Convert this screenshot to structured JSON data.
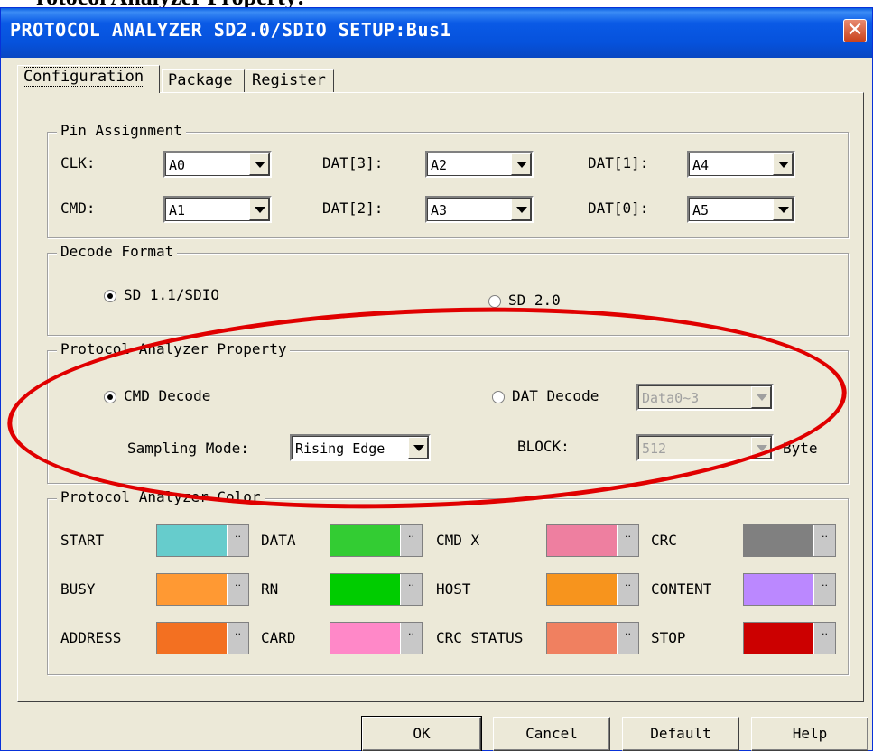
{
  "cut_heading": "rotocol Analyzer Property:",
  "window": {
    "title": "PROTOCOL ANALYZER SD2.0/SDIO SETUP:Bus1",
    "close_glyph": "✕"
  },
  "tabs": [
    "Configuration",
    "Package",
    "Register"
  ],
  "pin_assignment": {
    "title": "Pin Assignment",
    "pins": [
      {
        "label": "CLK:",
        "value": "A0"
      },
      {
        "label": "DAT[3]:",
        "value": "A2"
      },
      {
        "label": "DAT[1]:",
        "value": "A4"
      },
      {
        "label": "CMD:",
        "value": "A1"
      },
      {
        "label": "DAT[2]:",
        "value": "A3"
      },
      {
        "label": "DAT[0]:",
        "value": "A5"
      }
    ]
  },
  "decode_format": {
    "title": "Decode Format",
    "options": [
      "SD 1.1/SDIO",
      "SD 2.0"
    ],
    "selected": "SD 1.1/SDIO"
  },
  "analyzer_property": {
    "title": "Protocol Analyzer Property",
    "cmd_decode": "CMD Decode",
    "dat_decode": "DAT Decode",
    "dat_select": "Data0~3",
    "sampling_label": "Sampling Mode:",
    "sampling_value": "Rising Edge",
    "block_label": "BLOCK:",
    "block_value": "512",
    "block_unit": "Byte",
    "selected": "CMD Decode"
  },
  "analyzer_color": {
    "title": "Protocol Analyzer Color",
    "items": [
      {
        "label": "START",
        "color": "#66cccc"
      },
      {
        "label": "DATA",
        "color": "#33cc33"
      },
      {
        "label": "CMD X",
        "color": "#ee7fa0"
      },
      {
        "label": "CRC",
        "color": "#808080"
      },
      {
        "label": "BUSY",
        "color": "#ff9933"
      },
      {
        "label": "RN",
        "color": "#00cc00"
      },
      {
        "label": "HOST",
        "color": "#f7941d"
      },
      {
        "label": "CONTENT",
        "color": "#bb88ff"
      },
      {
        "label": "ADDRESS",
        "color": "#f37021"
      },
      {
        "label": "CARD",
        "color": "#ff88c8"
      },
      {
        "label": "CRC STATUS",
        "color": "#f08060"
      },
      {
        "label": "STOP",
        "color": "#cc0000"
      }
    ],
    "dots": "··"
  },
  "buttons": {
    "ok": "OK",
    "cancel": "Cancel",
    "default": "Default",
    "help": "Help"
  }
}
